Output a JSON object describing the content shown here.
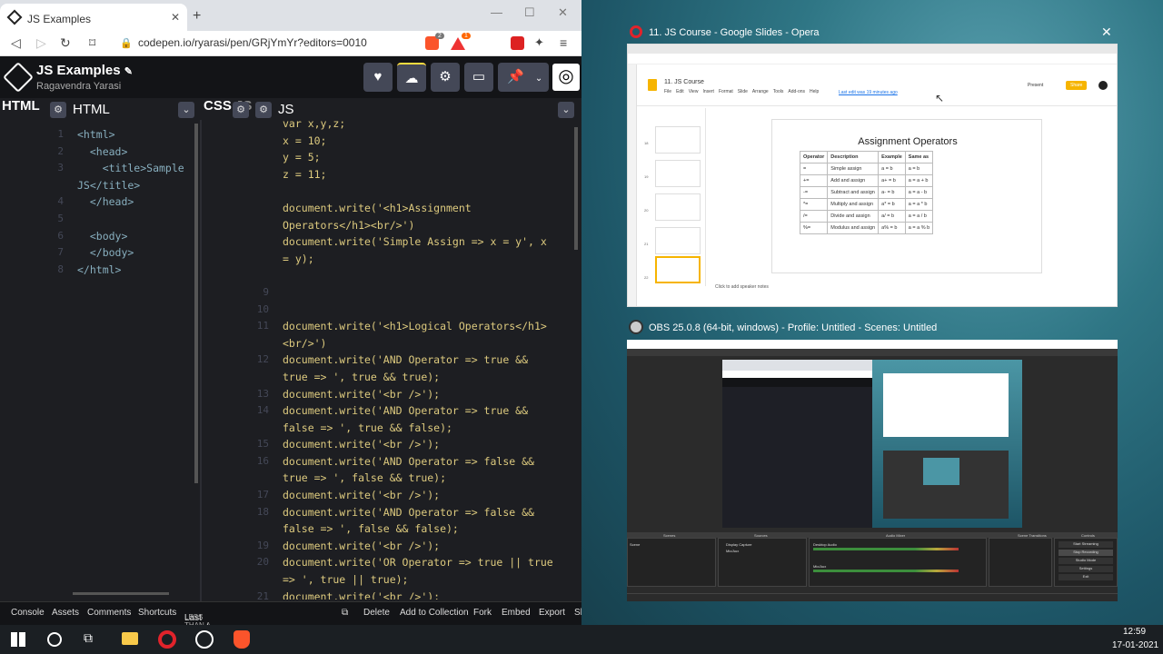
{
  "browser": {
    "tab_title": "JS Examples",
    "url": "codepen.io/ryarasi/pen/GRjYmYr?editors=0010",
    "ext_badge_1": "2",
    "ext_badge_2": "1"
  },
  "codepen": {
    "title": "JS Examples",
    "user": "Ragavendra Yarasi",
    "panel_html_label": "HTML",
    "panel_html_tab": "HTML",
    "panel_css_label": "CSS",
    "panel_js_label": "JS",
    "panel_css_cut": "JS"
  },
  "html_lines": [
    {
      "n": "1",
      "t": "<html>"
    },
    {
      "n": "2",
      "t": "  <head>"
    },
    {
      "n": "3",
      "t": "    <title>Sample"
    },
    {
      "n": "",
      "t": "JS</title>"
    },
    {
      "n": "4",
      "t": "  </head>"
    },
    {
      "n": "5",
      "t": ""
    },
    {
      "n": "6",
      "t": "  <body>"
    },
    {
      "n": "7",
      "t": "  </body>"
    },
    {
      "n": "8",
      "t": "</html>"
    }
  ],
  "js_lines": [
    {
      "n": "",
      "t": "var x,y,z;"
    },
    {
      "n": "",
      "t": "x = 10;"
    },
    {
      "n": "",
      "t": "y = 5;"
    },
    {
      "n": "",
      "t": "z = 11;"
    },
    {
      "n": "",
      "t": ""
    },
    {
      "n": "",
      "t": "document.write('<h1>Assignment"
    },
    {
      "n": "",
      "t": "Operators</h1><br/>')"
    },
    {
      "n": "",
      "t": "document.write('Simple Assign => x = y', x"
    },
    {
      "n": "",
      "t": "= y);"
    },
    {
      "n": "",
      "t": ""
    },
    {
      "n": "9",
      "t": ""
    },
    {
      "n": "10",
      "t": ""
    },
    {
      "n": "11",
      "t": "document.write('<h1>Logical Operators</h1>"
    },
    {
      "n": "",
      "t": "<br/>')"
    },
    {
      "n": "12",
      "t": "document.write('AND Operator => true &&"
    },
    {
      "n": "",
      "t": "true => ', true && true);"
    },
    {
      "n": "13",
      "t": "document.write('<br />');"
    },
    {
      "n": "14",
      "t": "document.write('AND Operator => true &&"
    },
    {
      "n": "",
      "t": "false => ', true && false);"
    },
    {
      "n": "15",
      "t": "document.write('<br />');"
    },
    {
      "n": "16",
      "t": "document.write('AND Operator => false &&"
    },
    {
      "n": "",
      "t": "true => ', false && true);"
    },
    {
      "n": "17",
      "t": "document.write('<br />');"
    },
    {
      "n": "18",
      "t": "document.write('AND Operator => false &&"
    },
    {
      "n": "",
      "t": "false => ', false && false);"
    },
    {
      "n": "19",
      "t": "document.write('<br />');"
    },
    {
      "n": "20",
      "t": "document.write('OR Operator => true || true"
    },
    {
      "n": "",
      "t": "=> ', true || true);"
    },
    {
      "n": "21",
      "t": "document.write('<br />');"
    }
  ],
  "footer": {
    "console": "Console",
    "assets": "Assets",
    "comments": "Comments",
    "shortcuts": "Shortcuts",
    "saved": "Last saved",
    "saved_time": "LESS THAN A MINUTE AGO",
    "delete": "Delete",
    "add_collection": "Add to Collection",
    "fork": "Fork",
    "embed": "Embed",
    "export": "Export",
    "share": "Sh"
  },
  "opera": {
    "window_title": "11. JS Course - Google Slides - Opera",
    "doc_title": "11. JS Course",
    "menu": [
      "File",
      "Edit",
      "View",
      "Insert",
      "Format",
      "Slide",
      "Arrange",
      "Tools",
      "Add-ons",
      "Help"
    ],
    "last_edit": "Last edit was 19 minutes ago",
    "present": "Present",
    "share": "Share",
    "speaker_notes": "Click to add speaker notes",
    "slide_title": "Assignment Operators",
    "table_head": [
      "Operator",
      "Description",
      "Example",
      "Same as"
    ],
    "table_rows": [
      [
        "=",
        "Simple assign",
        "a = b",
        "a = b"
      ],
      [
        "+=",
        "Add and assign",
        "a+ = b",
        "a = a + b"
      ],
      [
        "-=",
        "Subtract and assign",
        "a- = b",
        "a = a - b"
      ],
      [
        "*=",
        "Multiply and assign",
        "a* = b",
        "a = a * b"
      ],
      [
        "/=",
        "Divide and assign",
        "a/ = b",
        "a = a / b"
      ],
      [
        "%=",
        "Modulus and assign",
        "a% = b",
        "a = a % b"
      ]
    ],
    "thumb_nums": [
      "18",
      "19",
      "20",
      "21",
      "22"
    ]
  },
  "obs": {
    "window_title": "OBS 25.0.8 (64-bit, windows) - Profile: Untitled - Scenes: Untitled",
    "dock_labels": [
      "Scenes",
      "Sources",
      "Audio Mixer",
      "Scene Transitions",
      "Controls"
    ],
    "scene": "Scene",
    "sources": [
      "Display Capture",
      "Mic/Aux"
    ],
    "mixer": [
      "Desktop Audio",
      "Mic/Aux"
    ],
    "controls": [
      "Start Streaming",
      "Stop Recording",
      "Studio Mode",
      "Settings",
      "Exit"
    ]
  },
  "taskbar": {
    "time": "12:59",
    "date": "17-01-2021"
  }
}
